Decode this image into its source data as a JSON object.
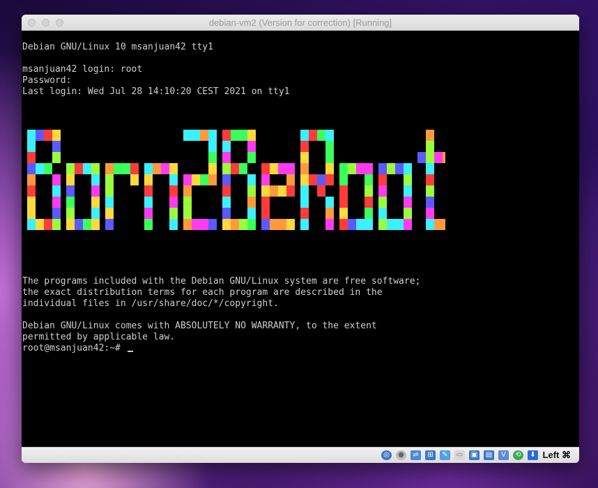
{
  "window": {
    "title": "debian-vm2 (Version for correction) [Running]"
  },
  "terminal": {
    "lines": [
      "Debian GNU/Linux 10 msanjuan42 tty1",
      "msanjuan42 login: root",
      "Password:",
      "Last login: Wed Jul 28 14:10:20 CEST 2021 on tty1",
      "The programs included with the Debian GNU/Linux system are free software;",
      "the exact distribution terms for each program are described in the",
      "individual files in /usr/share/doc/*/copyright.",
      "Debian GNU/Linux comes with ABSOLUTELY NO WARRANTY, to the extent",
      "permitted by applicable law."
    ],
    "prompt": "root@msanjuan42:~# ",
    "text_color": "#cfcfcf",
    "background": "#000000"
  },
  "banner": {
    "text": "Born2BeRoot",
    "palette": [
      "#ff3b3b",
      "#ffd93b",
      "#3bff5a",
      "#3bf0ff",
      "#5a5aff",
      "#ff3bf0",
      "#ff9a3b",
      "#9aff3b"
    ]
  },
  "statusbar": {
    "icons": [
      "hard-disk-icon",
      "optical-drive-icon",
      "usb-icon",
      "network-icon",
      "shared-folders-icon",
      "display-icon",
      "video-capture-icon",
      "recording-icon",
      "vm-icon",
      "cpu-icon",
      "mouse-integration-icon"
    ],
    "host_key": "Left ⌘"
  }
}
